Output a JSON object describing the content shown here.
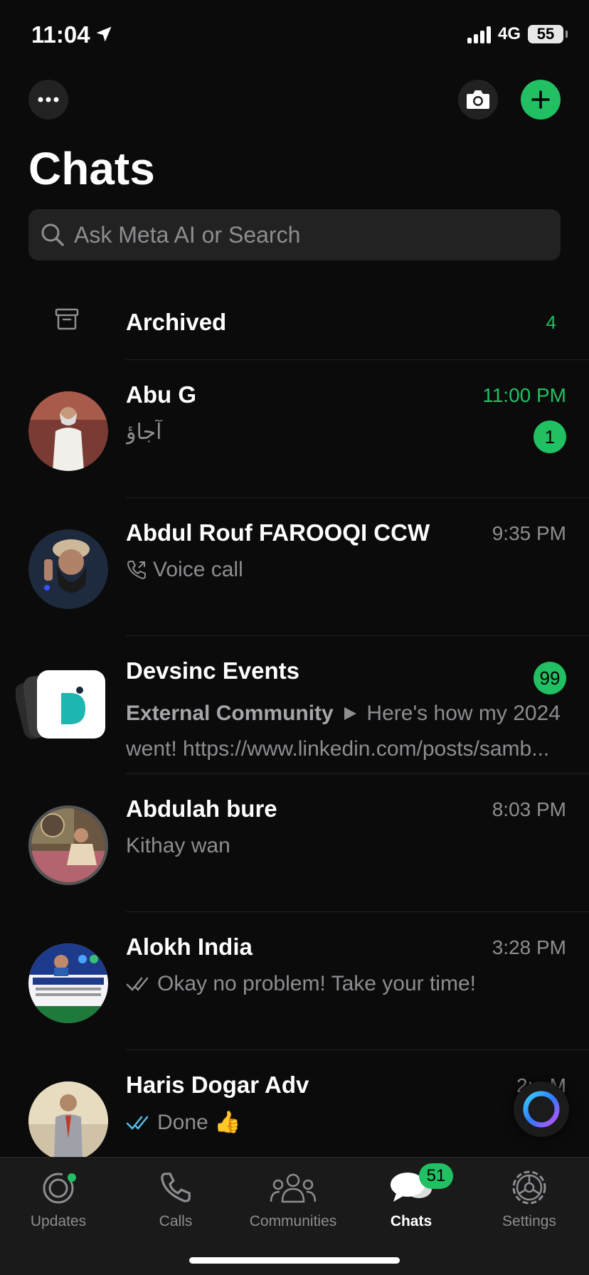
{
  "status_bar": {
    "time": "11:04",
    "network": "4G",
    "battery": "55"
  },
  "header": {
    "title": "Chats"
  },
  "search": {
    "placeholder": "Ask Meta AI or Search"
  },
  "archived": {
    "label": "Archived",
    "count": "4"
  },
  "chats": [
    {
      "name": "Abu G",
      "time": "11:00 PM",
      "preview": "آجاؤ",
      "unread": "1"
    },
    {
      "name": "Abdul Rouf FAROOQI CCW",
      "time": "9:35 PM",
      "preview": "Voice call"
    },
    {
      "name": "Devsinc Events",
      "preview_prefix": "External Community",
      "preview_line1": "Here's how my 2024",
      "preview_line2": "went! https://www.linkedin.com/posts/samb...",
      "unread": "99"
    },
    {
      "name": "Abdulah bure",
      "time": "8:03 PM",
      "preview": "Kithay wan"
    },
    {
      "name": "Alokh India",
      "time": "3:28 PM",
      "preview": "Okay no problem! Take your time!"
    },
    {
      "name": "Haris Dogar Adv",
      "time": "2:...M",
      "preview": "Done 👍"
    }
  ],
  "tabs": [
    {
      "label": "Updates"
    },
    {
      "label": "Calls"
    },
    {
      "label": "Communities"
    },
    {
      "label": "Chats",
      "badge": "51"
    },
    {
      "label": "Settings"
    }
  ],
  "colors": {
    "accent": "#21c063",
    "background": "#0b0b0b",
    "muted": "#8d8d92"
  }
}
